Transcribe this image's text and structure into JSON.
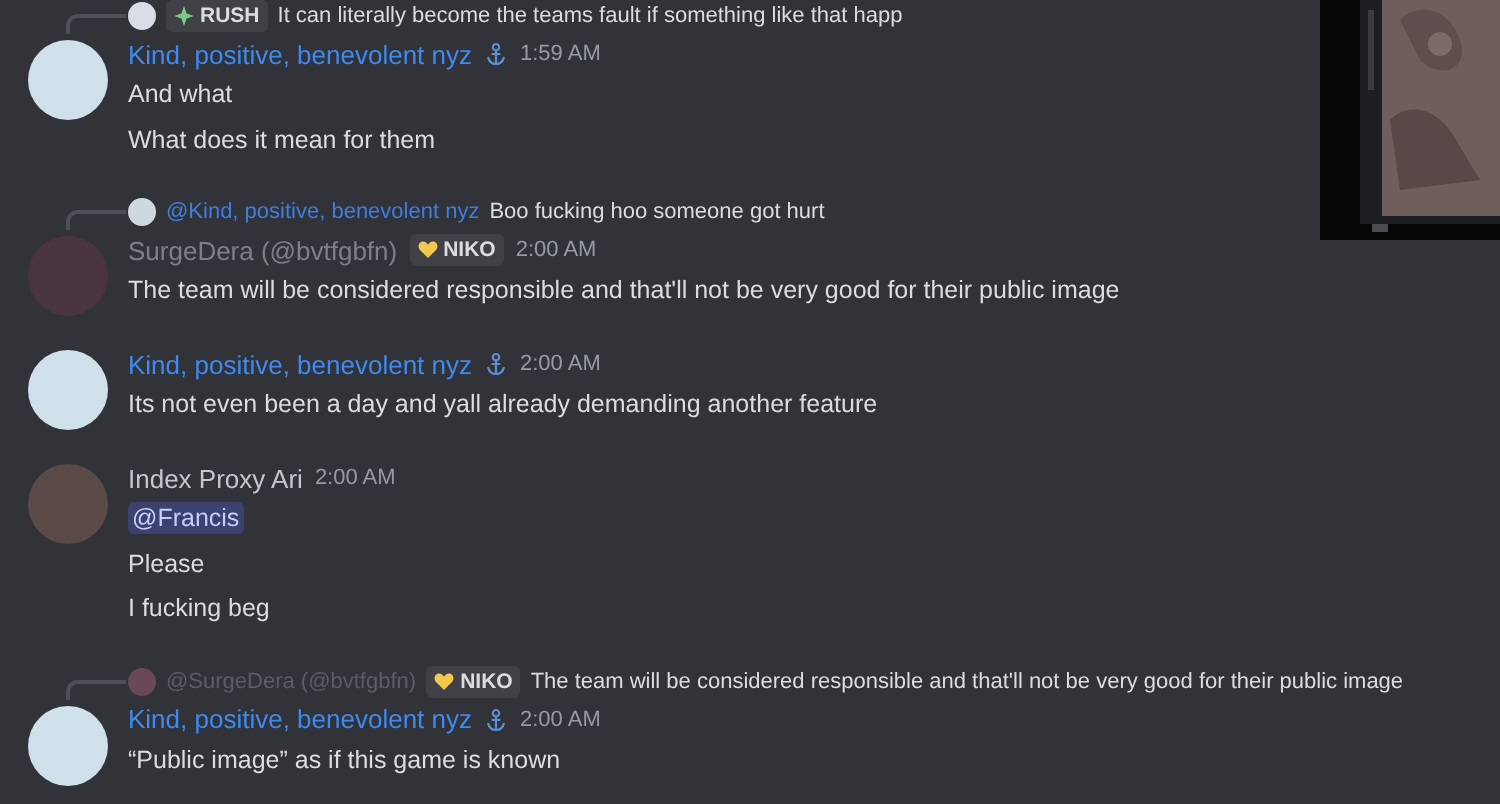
{
  "messages": [
    {
      "reply": {
        "avatar": {
          "color": "#d8dde6"
        },
        "tag": {
          "kind": "sparkle",
          "label": "RUSH"
        },
        "text": "It can literally become the teams fault if something like that happ"
      },
      "avatar": {
        "color": "#cfe0ea"
      },
      "author": {
        "name": "Kind, positive, benevolent nyz",
        "color": "#3d8bf2"
      },
      "role_icon": true,
      "time": "1:59 AM",
      "lines": [
        {
          "kind": "text",
          "text": "And what"
        },
        {
          "kind": "text",
          "text": "What does it mean for them"
        }
      ]
    },
    {
      "reply": {
        "avatar": {
          "color": "#cfd8de"
        },
        "author": {
          "name": "@Kind, positive, benevolent nyz",
          "color": "#3d7fe0"
        },
        "text": "Boo fucking hoo someone got hurt"
      },
      "avatar": {
        "color": "#4a3440"
      },
      "author": {
        "name": "SurgeDera (@bvtfgbfn)",
        "color": "#7d8088"
      },
      "tag": {
        "kind": "heart",
        "label": "NIKO"
      },
      "role_icon": false,
      "time": "2:00 AM",
      "lines": [
        {
          "kind": "text",
          "text": "The team will be considered responsible and that'll not be very good for their public image"
        }
      ]
    },
    {
      "avatar": {
        "color": "#cfe0ea"
      },
      "author": {
        "name": "Kind, positive, benevolent nyz",
        "color": "#3d8bf2"
      },
      "role_icon": true,
      "time": "2:00 AM",
      "lines": [
        {
          "kind": "text",
          "text": "Its not even been a day and yall already demanding another feature"
        }
      ]
    },
    {
      "avatar": {
        "color": "#5a4a48"
      },
      "author": {
        "name": "Index Proxy Ari",
        "color": "#c4c8ce"
      },
      "role_icon": false,
      "time": "2:00 AM",
      "lines": [
        {
          "kind": "mention",
          "text": "@Francis"
        },
        {
          "kind": "text",
          "text": "Please"
        },
        {
          "kind": "text",
          "text": "I fucking beg"
        }
      ]
    },
    {
      "reply": {
        "avatar": {
          "color": "#6a4855"
        },
        "author": {
          "name": "@SurgeDera (@bvtfgbfn)",
          "color": "#5a5d66"
        },
        "tag": {
          "kind": "heart",
          "label": "NIKO"
        },
        "text": "The team will be considered responsible and that'll not be very good for their public image"
      },
      "avatar": {
        "color": "#cfe0ea"
      },
      "author": {
        "name": "Kind, positive, benevolent nyz",
        "color": "#3d8bf2"
      },
      "role_icon": true,
      "time": "2:00 AM",
      "lines": [
        {
          "kind": "text",
          "text": "“Public image” as if this game is known"
        }
      ]
    }
  ]
}
